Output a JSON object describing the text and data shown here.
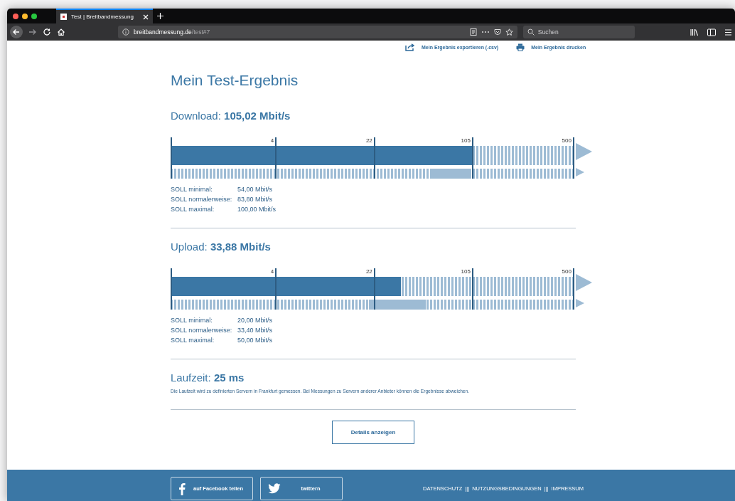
{
  "browser": {
    "tab_title": "Test | Breitbandmessung",
    "url_host": "breitbandmessung.de",
    "url_path": "/test#7",
    "search_placeholder": "Suchen"
  },
  "actions": [
    {
      "kind": "export",
      "label": "Mein Ergebnis exportieren (.csv)"
    },
    {
      "kind": "print",
      "label": "Mein Ergebnis drucken"
    }
  ],
  "title": "Mein Test-Ergebnis",
  "measurements": [
    {
      "heading": "Download: **105,02 Mbit/s**",
      "level": 0.748,
      "ticks": [
        {
          "label": "4",
          "level": 0.261
        },
        {
          "label": "22",
          "level": 0.505
        },
        {
          "label": "105",
          "level": 0.748
        },
        {
          "label": "500",
          "level": 0.998
        }
      ],
      "targets": [
        {
          "label": "SOLL minimal:",
          "value": "54,00 Mbit/s"
        },
        {
          "label": "SOLL normalerweise:",
          "value": "83,80 Mbit/s"
        },
        {
          "label": "SOLL maximal:",
          "value": "100,00 Mbit/s"
        }
      ]
    },
    {
      "heading": "Upload: **33,88 Mbit/s**",
      "level": 0.57,
      "ticks": [
        {
          "label": "4",
          "level": 0.261
        },
        {
          "label": "22",
          "level": 0.505
        },
        {
          "label": "105",
          "level": 0.748
        },
        {
          "label": "500",
          "level": 0.998
        }
      ],
      "targets": [
        {
          "label": "SOLL minimal:",
          "value": "20,00 Mbit/s"
        },
        {
          "label": "SOLL normalerweise:",
          "value": "33,40 Mbit/s"
        },
        {
          "label": "SOLL maximal:",
          "value": "50,00 Mbit/s"
        }
      ]
    }
  ],
  "latency": {
    "heading": "Laufzeit: **25 ms**",
    "note": "Die Laufzeit wird zu definierten Servern in Frankfurt gemessen. Bei Messungen zu Servern anderer Anbieter können die Ergebnisse abweichen."
  },
  "details_button": "Details anzeigen",
  "share_buttons": [
    {
      "kind": "facebook",
      "label": "auf Facebook teilen"
    },
    {
      "kind": "twitter",
      "label": "twittern"
    }
  ],
  "footer_items": [
    {
      "kind": "link",
      "label": "DATENSCHUTZ"
    },
    {
      "kind": "separator",
      "label": "|||"
    },
    {
      "kind": "link",
      "label": "NUTZUNGSBEDINGUNGEN"
    },
    {
      "kind": "separator",
      "label": "|||"
    },
    {
      "kind": "link",
      "label": "IMPRESSUM"
    }
  ]
}
